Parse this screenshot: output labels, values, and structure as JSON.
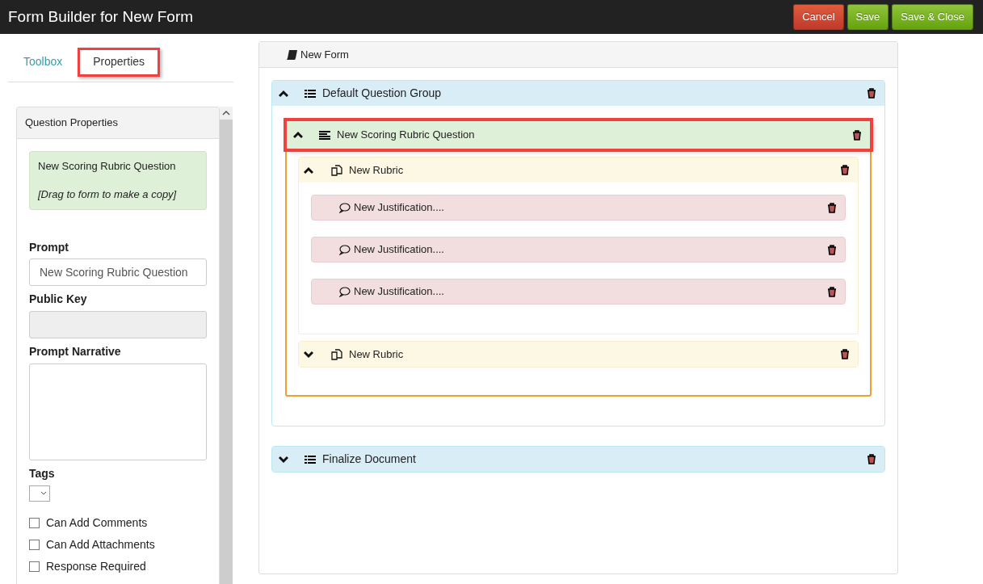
{
  "window": {
    "title": "Form Builder for New Form"
  },
  "buttons": [
    {
      "label": "Cancel",
      "kind": "danger"
    },
    {
      "label": "Save",
      "kind": "success"
    },
    {
      "label": "Save & Close",
      "kind": "success"
    }
  ],
  "tabs": [
    {
      "label": "Toolbox",
      "selected": false,
      "highlighted": false
    },
    {
      "label": "Properties",
      "selected": true,
      "highlighted": true
    }
  ],
  "properties": {
    "title": "Question Properties",
    "toolbox_item": {
      "title": "New Scoring Rubric Question",
      "hint": "[Drag to form to make a copy]"
    },
    "fields": [
      {
        "kind": "text",
        "label": "Prompt",
        "value": "New Scoring Rubric Question",
        "disabled": false
      },
      {
        "kind": "text",
        "label": "Public Key",
        "disabled": true
      },
      {
        "kind": "textarea",
        "label": "Prompt Narrative",
        "disabled": false
      },
      {
        "kind": "select",
        "label": "Tags",
        "disabled": false
      }
    ],
    "checkboxes": [
      {
        "label": "Can Add Comments",
        "checked": false
      },
      {
        "label": "Can Add Attachments",
        "checked": false
      },
      {
        "label": "Response Required",
        "checked": false
      }
    ]
  },
  "form": {
    "title": "New Form",
    "groups": [
      {
        "title": "Default Question Group",
        "expanded": true,
        "children": [
          {
            "title": "New Scoring Rubric Question",
            "expanded": true,
            "highlighted": true,
            "children": [
              {
                "title": "New Rubric",
                "expanded": true,
                "children": [
                  {
                    "title": "New Justification...."
                  },
                  {
                    "title": "New Justification...."
                  },
                  {
                    "title": "New Justification...."
                  }
                ]
              },
              {
                "title": "New Rubric",
                "expanded": false
              }
            ]
          }
        ]
      },
      {
        "title": "Finalize Document",
        "expanded": false
      }
    ]
  }
}
